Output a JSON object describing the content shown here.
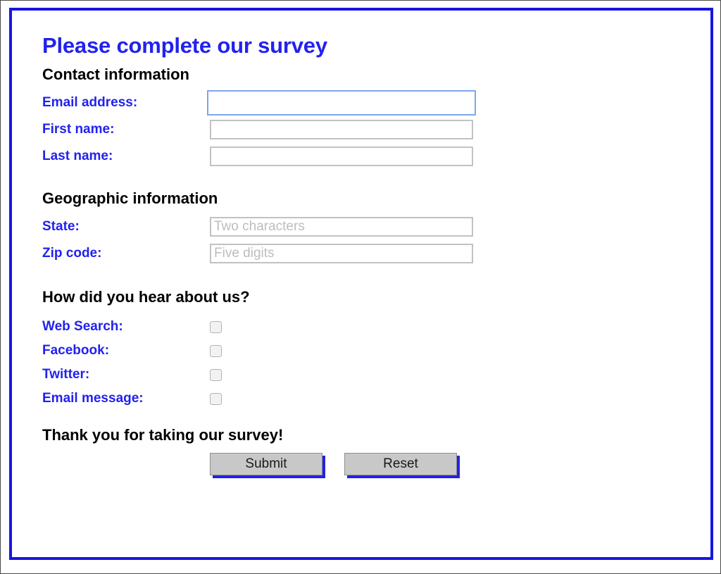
{
  "page": {
    "title": "Please complete our survey",
    "frame_border_color": "#1616e0",
    "label_color": "#2222ee",
    "heading_color": "#000000"
  },
  "contact_section": {
    "heading": "Contact information",
    "fields": [
      {
        "label": "Email address:",
        "value": "",
        "placeholder": "",
        "focused": true
      },
      {
        "label": "First name:",
        "value": "",
        "placeholder": "",
        "focused": false
      },
      {
        "label": "Last name:",
        "value": "",
        "placeholder": "",
        "focused": false
      }
    ]
  },
  "geographic_section": {
    "heading": "Geographic information",
    "fields": [
      {
        "label": "State:",
        "value": "",
        "placeholder": "Two characters"
      },
      {
        "label": "Zip code:",
        "value": "",
        "placeholder": "Five digits"
      }
    ]
  },
  "referral_section": {
    "heading": "How did you hear about us?",
    "options": [
      {
        "label": "Web Search:",
        "checked": false
      },
      {
        "label": "Facebook:",
        "checked": false
      },
      {
        "label": "Twitter:",
        "checked": false
      },
      {
        "label": "Email message:",
        "checked": false
      }
    ]
  },
  "footer": {
    "thanks": "Thank you for taking our survey!",
    "submit_label": "Submit",
    "reset_label": "Reset",
    "button_shadow_color": "#2222e0"
  }
}
